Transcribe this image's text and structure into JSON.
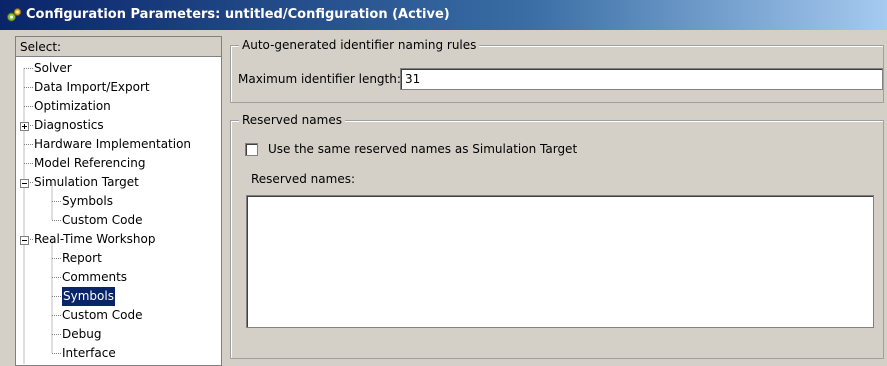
{
  "window": {
    "title": "Configuration Parameters: untitled/Configuration (Active)",
    "icon": "configuration-gear-icon"
  },
  "tree": {
    "header": "Select:",
    "items": [
      {
        "label": "Solver",
        "level": 0,
        "expander": "none"
      },
      {
        "label": "Data Import/Export",
        "level": 0,
        "expander": "none"
      },
      {
        "label": "Optimization",
        "level": 0,
        "expander": "none"
      },
      {
        "label": "Diagnostics",
        "level": 0,
        "expander": "plus"
      },
      {
        "label": "Hardware Implementation",
        "level": 0,
        "expander": "none"
      },
      {
        "label": "Model Referencing",
        "level": 0,
        "expander": "none"
      },
      {
        "label": "Simulation Target",
        "level": 0,
        "expander": "minus"
      },
      {
        "label": "Symbols",
        "level": 1,
        "expander": "none"
      },
      {
        "label": "Custom Code",
        "level": 1,
        "expander": "none"
      },
      {
        "label": "Real-Time Workshop",
        "level": 0,
        "expander": "minus"
      },
      {
        "label": "Report",
        "level": 1,
        "expander": "none"
      },
      {
        "label": "Comments",
        "level": 1,
        "expander": "none"
      },
      {
        "label": "Symbols",
        "level": 1,
        "expander": "none",
        "selected": true
      },
      {
        "label": "Custom Code",
        "level": 1,
        "expander": "none"
      },
      {
        "label": "Debug",
        "level": 1,
        "expander": "none"
      },
      {
        "label": "Interface",
        "level": 1,
        "expander": "none"
      }
    ]
  },
  "naming_rules": {
    "legend": "Auto-generated identifier naming rules",
    "max_length_label": "Maximum identifier length:",
    "max_length_value": "31"
  },
  "reserved": {
    "legend": "Reserved names",
    "checkbox_label": "Use the same reserved names as Simulation Target",
    "checkbox_checked": false,
    "list_label": "Reserved names:",
    "list_value": ""
  },
  "colors": {
    "title_bar": "#0a246a",
    "selection": "#0a246a",
    "dialog_background": "#d4d0c8"
  }
}
